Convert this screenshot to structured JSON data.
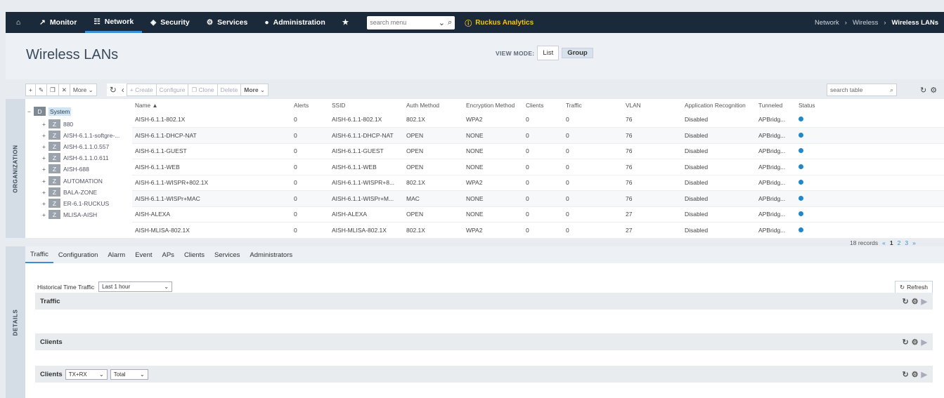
{
  "nav": {
    "items": [
      {
        "label": "Monitor",
        "icon": "chart-line-icon"
      },
      {
        "label": "Network",
        "icon": "network-icon"
      },
      {
        "label": "Security",
        "icon": "shield-icon"
      },
      {
        "label": "Services",
        "icon": "gears-icon"
      },
      {
        "label": "Administration",
        "icon": "user-icon"
      }
    ],
    "search_placeholder": "search menu",
    "analytics": "Ruckus Analytics",
    "breadcrumb": [
      "Network",
      "Wireless",
      "Wireless LANs"
    ]
  },
  "page": {
    "title": "Wireless LANs",
    "viewmode_label": "VIEW MODE:",
    "viewmode_options": [
      "List",
      "Group"
    ]
  },
  "toolbar": {
    "more1": "More",
    "create": "Create",
    "configure": "Configure",
    "clone": "Clone",
    "delete": "Delete",
    "more2": "More",
    "search_placeholder": "search table"
  },
  "side": {
    "organization": "ORGANIZATION",
    "details": "DETAILS"
  },
  "tree": {
    "root": {
      "tag": "D",
      "name": "System"
    },
    "children": [
      {
        "tag": "Z",
        "name": "880"
      },
      {
        "tag": "Z",
        "name": "AISH-6.1.1-softgre-..."
      },
      {
        "tag": "Z",
        "name": "AISH-6.1.1.0.557"
      },
      {
        "tag": "Z",
        "name": "AISH-6.1.1.0.611"
      },
      {
        "tag": "Z",
        "name": "AISH-688"
      },
      {
        "tag": "Z",
        "name": "AUTOMATION"
      },
      {
        "tag": "Z",
        "name": "BALA-ZONE"
      },
      {
        "tag": "Z",
        "name": "ER-6.1-RUCKUS"
      },
      {
        "tag": "Z",
        "name": "MLISA-AISH"
      }
    ]
  },
  "table": {
    "columns": [
      "Name ▲",
      "Alerts",
      "SSID",
      "Auth Method",
      "Encryption Method",
      "Clients",
      "Traffic",
      "VLAN",
      "Application Recognition",
      "Tunneled",
      "Status"
    ],
    "rows": [
      [
        "AISH-6.1.1-802.1X",
        "0",
        "AISH-6.1.1-802.1X",
        "802.1X",
        "WPA2",
        "0",
        "0",
        "76",
        "Disabled",
        "APBridg..."
      ],
      [
        "AISH-6.1.1-DHCP-NAT",
        "0",
        "AISH-6.1.1-DHCP-NAT",
        "OPEN",
        "NONE",
        "0",
        "0",
        "76",
        "Disabled",
        "APBridg..."
      ],
      [
        "AISH-6.1.1-GUEST",
        "0",
        "AISH-6.1.1-GUEST",
        "OPEN",
        "NONE",
        "0",
        "0",
        "76",
        "Disabled",
        "APBridg..."
      ],
      [
        "AISH-6.1.1-WEB",
        "0",
        "AISH-6.1.1-WEB",
        "OPEN",
        "NONE",
        "0",
        "0",
        "76",
        "Disabled",
        "APBridg..."
      ],
      [
        "AISH-6.1.1-WISPR+802.1X",
        "0",
        "AISH-6.1.1-WISPR+8...",
        "802.1X",
        "WPA2",
        "0",
        "0",
        "76",
        "Disabled",
        "APBridg..."
      ],
      [
        "AISH-6.1.1-WISPr+MAC",
        "0",
        "AISH-6.1.1-WISPr+M...",
        "MAC",
        "NONE",
        "0",
        "0",
        "76",
        "Disabled",
        "APBridg..."
      ],
      [
        "AISH-ALEXA",
        "0",
        "AISH-ALEXA",
        "OPEN",
        "NONE",
        "0",
        "0",
        "27",
        "Disabled",
        "APBridg..."
      ],
      [
        "AISH-MLISA-802.1X",
        "0",
        "AISH-MLISA-802.1X",
        "802.1X",
        "WPA2",
        "0",
        "0",
        "27",
        "Disabled",
        "APBridg..."
      ]
    ],
    "status_color": "#1e88c8",
    "records": "18 records",
    "pages": [
      "«",
      "1",
      "2",
      "3",
      "»"
    ]
  },
  "details": {
    "tabs": [
      "Traffic",
      "Configuration",
      "Alarm",
      "Event",
      "APs",
      "Clients",
      "Services",
      "Administrators"
    ],
    "htt_label": "Historical Time Traffic",
    "htt_value": "Last 1 hour",
    "refresh": "Refresh",
    "panels": [
      "Traffic",
      "Clients",
      "Clients"
    ],
    "clients_sel1": "TX+RX",
    "clients_sel2": "Total"
  }
}
